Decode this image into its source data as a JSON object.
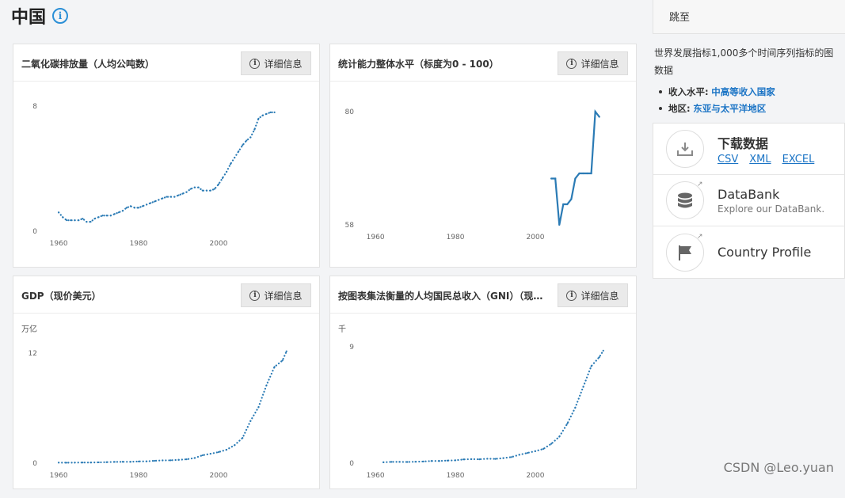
{
  "page": {
    "title": "中国"
  },
  "cards": [
    {
      "title": "二氧化碳排放量（人均公吨数）",
      "detail": "详细信息",
      "unit": ""
    },
    {
      "title": "统计能力整体水平（标度为0 - 100）",
      "detail": "详细信息",
      "unit": ""
    },
    {
      "title": "GDP（现价美元）",
      "detail": "详细信息",
      "unit": "万亿"
    },
    {
      "title": "按图表集法衡量的人均国民总收入（GNI）（现价美元）",
      "detail": "详细信息",
      "unit": "千"
    }
  ],
  "chart_data": [
    {
      "type": "line",
      "title": "二氧化碳排放量（人均公吨数）",
      "y_ticks": [
        "8",
        "0"
      ],
      "ylim": [
        0,
        8
      ],
      "x_ticks": [
        "1960",
        "1980",
        "2000"
      ],
      "xlim": [
        1958,
        2022
      ],
      "x": [
        1960,
        1961,
        1962,
        1963,
        1964,
        1965,
        1966,
        1967,
        1968,
        1969,
        1970,
        1971,
        1972,
        1973,
        1974,
        1975,
        1976,
        1977,
        1978,
        1979,
        1980,
        1981,
        1982,
        1983,
        1984,
        1985,
        1986,
        1987,
        1988,
        1989,
        1990,
        1991,
        1992,
        1993,
        1994,
        1995,
        1996,
        1997,
        1998,
        1999,
        2000,
        2001,
        2002,
        2003,
        2004,
        2005,
        2006,
        2007,
        2008,
        2009,
        2010,
        2011,
        2012,
        2013,
        2014
      ],
      "values": [
        1.2,
        0.9,
        0.7,
        0.7,
        0.7,
        0.7,
        0.8,
        0.6,
        0.6,
        0.8,
        0.9,
        1.0,
        1.0,
        1.0,
        1.1,
        1.2,
        1.3,
        1.5,
        1.6,
        1.5,
        1.5,
        1.6,
        1.7,
        1.8,
        1.9,
        2.0,
        2.1,
        2.2,
        2.2,
        2.2,
        2.3,
        2.4,
        2.5,
        2.7,
        2.8,
        2.8,
        2.6,
        2.6,
        2.6,
        2.7,
        3.0,
        3.4,
        3.8,
        4.3,
        4.7,
        5.1,
        5.5,
        5.8,
        6.0,
        6.5,
        7.2,
        7.4,
        7.5,
        7.6,
        7.6
      ]
    },
    {
      "type": "line",
      "title": "统计能力整体水平（标度为0 - 100）",
      "y_ticks": [
        "80",
        "58"
      ],
      "ylim": [
        58,
        80
      ],
      "x_ticks": [
        "1960",
        "1980",
        "2000"
      ],
      "xlim": [
        1958,
        2022
      ],
      "x": [
        2004,
        2005,
        2006,
        2007,
        2008,
        2009,
        2010,
        2011,
        2012,
        2013,
        2014,
        2015,
        2016
      ],
      "values": [
        67,
        67,
        58,
        62,
        62,
        63,
        67,
        68,
        68,
        68,
        68,
        80,
        79
      ]
    },
    {
      "type": "line",
      "title": "GDP（现价美元）",
      "y_ticks": [
        "12",
        "0"
      ],
      "ylim": [
        0,
        12
      ],
      "x_ticks": [
        "1960",
        "1980",
        "2000"
      ],
      "xlim": [
        1958,
        2022
      ],
      "x": [
        1960,
        1962,
        1964,
        1966,
        1968,
        1970,
        1972,
        1974,
        1976,
        1978,
        1980,
        1982,
        1984,
        1986,
        1988,
        1990,
        1992,
        1994,
        1996,
        1998,
        2000,
        2002,
        2004,
        2006,
        2008,
        2010,
        2012,
        2014,
        2016,
        2017
      ],
      "values": [
        0.06,
        0.05,
        0.06,
        0.07,
        0.07,
        0.09,
        0.11,
        0.14,
        0.15,
        0.15,
        0.19,
        0.2,
        0.26,
        0.3,
        0.31,
        0.36,
        0.42,
        0.56,
        0.86,
        1.03,
        1.21,
        1.47,
        1.96,
        2.75,
        4.6,
        6.1,
        8.5,
        10.5,
        11.2,
        12.2
      ]
    },
    {
      "type": "line",
      "title": "按图表集法衡量的人均国民总收入（GNI）（现价美元）",
      "y_ticks": [
        "9",
        "0"
      ],
      "ylim": [
        0,
        9
      ],
      "x_ticks": [
        "1960",
        "1980",
        "2000"
      ],
      "xlim": [
        1958,
        2022
      ],
      "x": [
        1962,
        1964,
        1966,
        1968,
        1970,
        1972,
        1974,
        1976,
        1978,
        1980,
        1982,
        1984,
        1986,
        1988,
        1990,
        1992,
        1994,
        1996,
        1998,
        2000,
        2002,
        2004,
        2006,
        2008,
        2010,
        2012,
        2014,
        2016,
        2017
      ],
      "values": [
        0.07,
        0.1,
        0.1,
        0.09,
        0.11,
        0.13,
        0.17,
        0.17,
        0.2,
        0.22,
        0.29,
        0.31,
        0.3,
        0.34,
        0.33,
        0.39,
        0.47,
        0.65,
        0.79,
        0.93,
        1.1,
        1.5,
        2.05,
        3.05,
        4.3,
        5.9,
        7.5,
        8.2,
        8.7
      ]
    }
  ],
  "sidebar": {
    "jump": "跳至",
    "desc_line1": "世界发展指标1,000多个时间序列指标的图",
    "desc_line2": "数据",
    "income_label": "收入水平:",
    "income_value": "中高等收入国家",
    "region_label": "地区:",
    "region_value": "东亚与太平洋地区",
    "download": {
      "title": "下载数据",
      "links": [
        "CSV",
        "XML",
        "EXCEL"
      ]
    },
    "databank": {
      "title": "DataBank",
      "sub": "Explore our DataBank."
    },
    "profile": {
      "title": "Country Profile"
    }
  },
  "watermark": "CSDN @Leo.yuan",
  "colors": {
    "line": "#2b7bb5",
    "link": "#1b74c5",
    "info": "#2b8fd6"
  }
}
